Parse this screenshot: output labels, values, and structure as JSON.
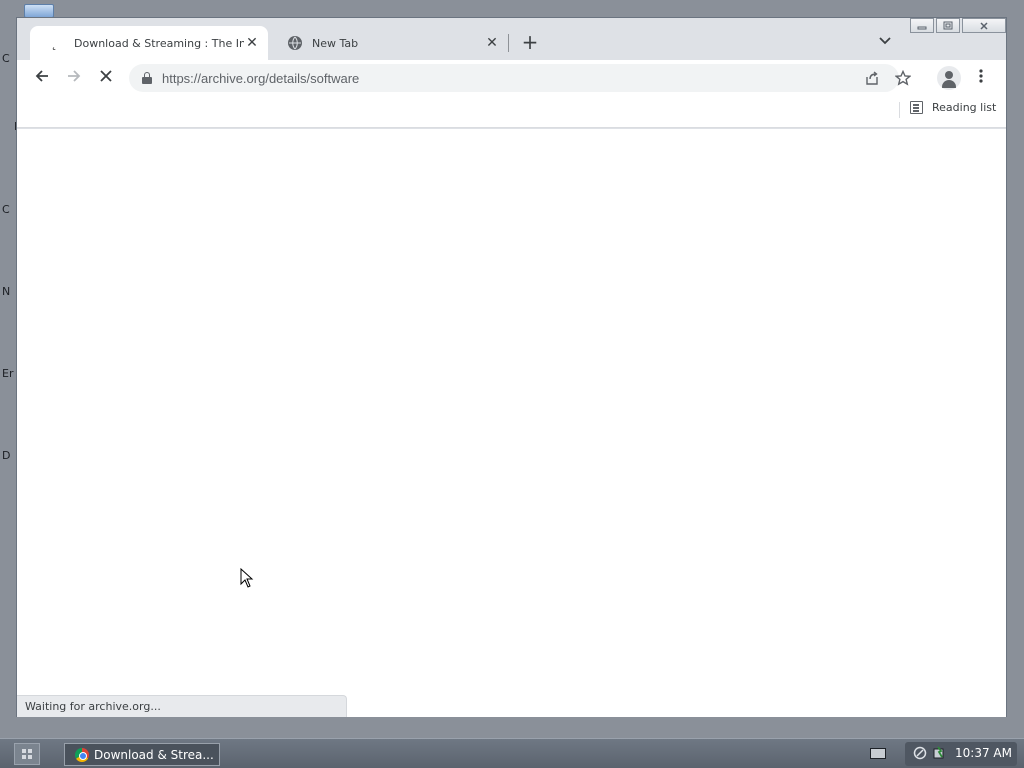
{
  "desktop": {
    "icon_fragments": [
      "C",
      "I",
      "C",
      "N",
      "Er",
      "D"
    ]
  },
  "window": {
    "controls": {
      "minimize_icon": "minimize-icon",
      "maximize_icon": "maximize-icon",
      "close_icon": "close-icon"
    }
  },
  "tabs": [
    {
      "title": "Download & Streaming : The Intern",
      "icon": "loading-throbber-icon",
      "active": true
    },
    {
      "title": "New Tab",
      "icon": "globe-icon",
      "active": false
    }
  ],
  "toolbar": {
    "url": "https://archive.org/details/software"
  },
  "bookmarks_bar": {
    "reading_list_label": "Reading list"
  },
  "status": {
    "text": "Waiting for archive.org..."
  },
  "taskbar": {
    "task_label": "Download & Strea...",
    "clock": "10:37 AM"
  },
  "colors": {
    "desktop_bg": "#8a9099",
    "tabstrip_bg": "#dee1e6",
    "omnibox_bg": "#f1f3f4",
    "taskbar_bg": "#5b636e"
  }
}
